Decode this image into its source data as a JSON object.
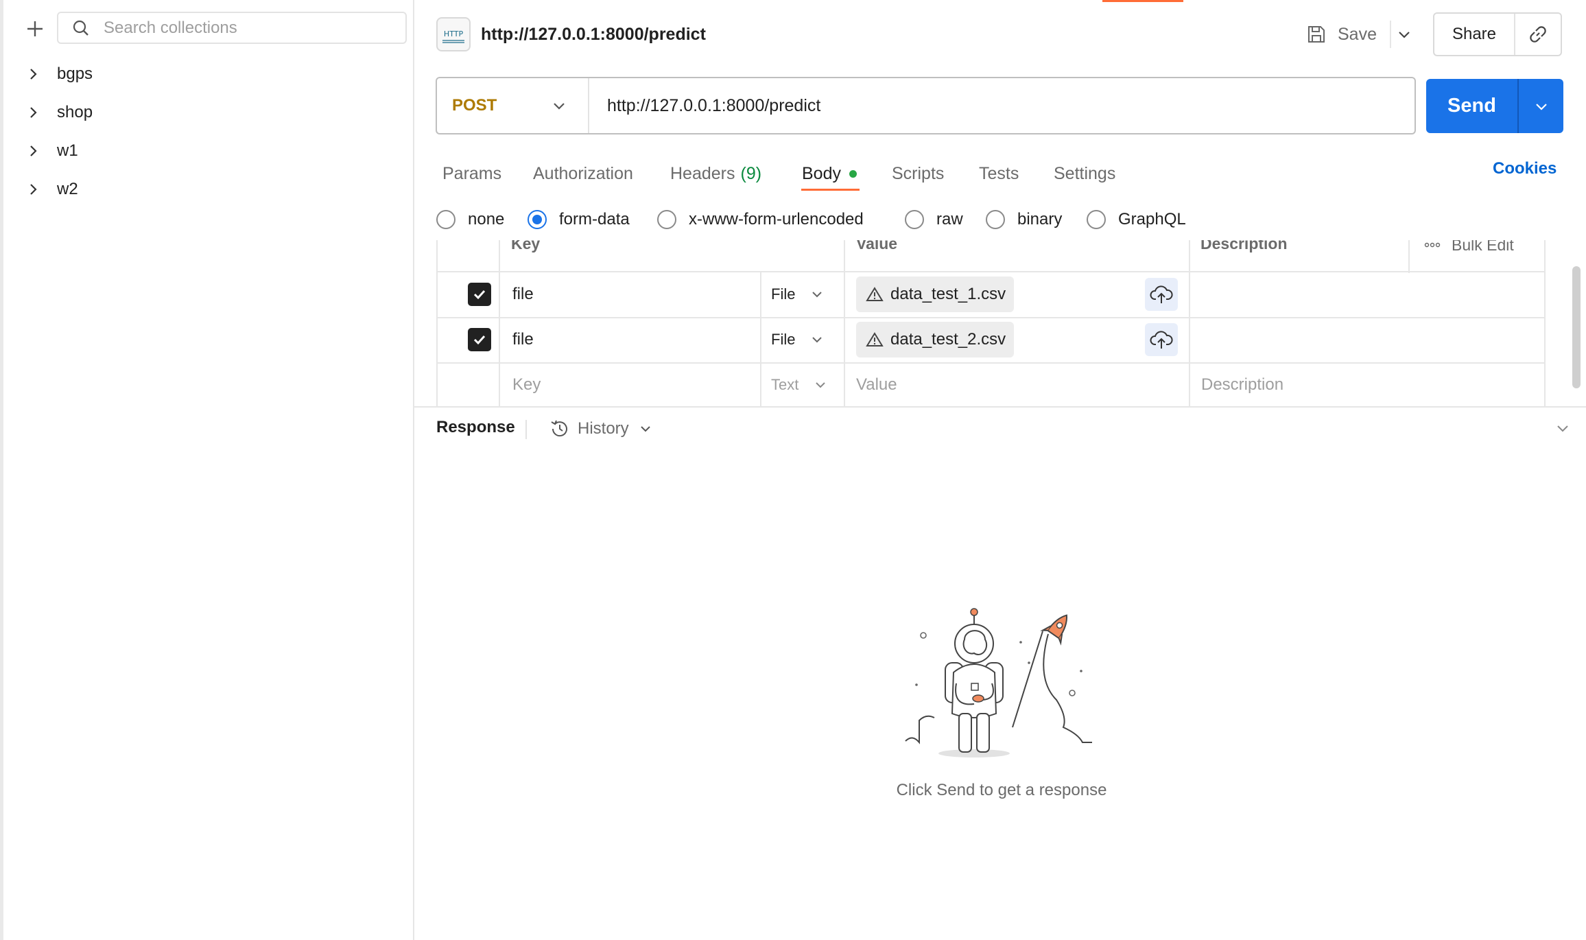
{
  "sidebar": {
    "search_placeholder": "Search collections",
    "collections": [
      {
        "label": "bgps"
      },
      {
        "label": "shop"
      },
      {
        "label": "w1"
      },
      {
        "label": "w2"
      }
    ]
  },
  "request": {
    "title": "http://127.0.0.1:8000/predict",
    "http_badge": "HTTP",
    "save_label": "Save",
    "share_label": "Share",
    "method": "POST",
    "url": "http://127.0.0.1:8000/predict",
    "send_label": "Send"
  },
  "tabs": [
    {
      "label": "Params"
    },
    {
      "label": "Authorization"
    },
    {
      "label": "Headers",
      "count": "(9)"
    },
    {
      "label": "Body"
    },
    {
      "label": "Scripts"
    },
    {
      "label": "Tests"
    },
    {
      "label": "Settings"
    }
  ],
  "cookies_label": "Cookies",
  "body_types": [
    {
      "label": "none"
    },
    {
      "label": "form-data",
      "selected": true
    },
    {
      "label": "x-www-form-urlencoded"
    },
    {
      "label": "raw"
    },
    {
      "label": "binary"
    },
    {
      "label": "GraphQL"
    }
  ],
  "params_table": {
    "headers": {
      "key": "Key",
      "value": "Value",
      "description": "Description",
      "bulk_edit": "Bulk Edit"
    },
    "rows": [
      {
        "key": "file",
        "type": "File",
        "value": "data_test_1.csv"
      },
      {
        "key": "file",
        "type": "File",
        "value": "data_test_2.csv"
      }
    ],
    "new_row": {
      "key_placeholder": "Key",
      "type": "Text",
      "value_placeholder": "Value",
      "description_placeholder": "Description"
    }
  },
  "response": {
    "title": "Response",
    "history_label": "History",
    "empty_message": "Click Send to get a response"
  },
  "colors": {
    "accent": "#ff6c37",
    "send": "#1a73e8",
    "method_post": "#ad7a03",
    "link": "#0265d2"
  }
}
